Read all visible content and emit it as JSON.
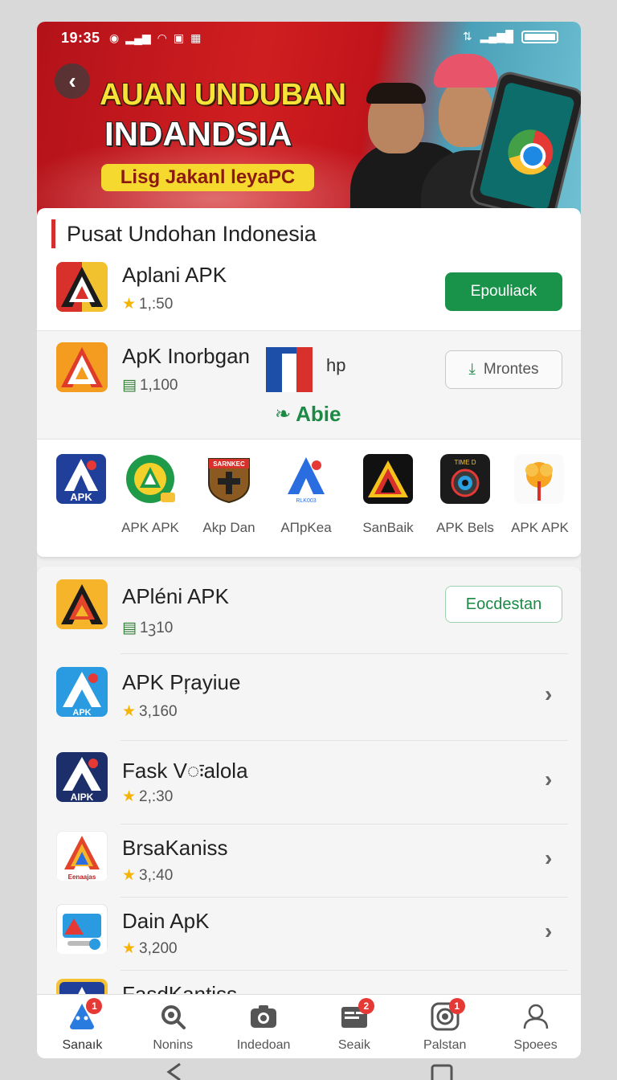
{
  "status_bar": {
    "time": "19:35"
  },
  "banner": {
    "title_line1": "AUAN UNDUBAN",
    "title_line2": "INDANDSIA",
    "pill_text": "Lisg Jakanl leyaPC"
  },
  "section": {
    "title": "Pusat Undohan Indonesia"
  },
  "featured": [
    {
      "name": "Aplani APK",
      "meta": "1,:50",
      "meta_icon": "star-icon",
      "action": "Epouliack"
    },
    {
      "name": "ApK Inorbgan",
      "meta": "1,100",
      "meta_icon": "download-icon",
      "action": "Mrontes",
      "extra_text": "hp",
      "extra_label": "Abie"
    }
  ],
  "icon_grid": [
    {
      "label": ""
    },
    {
      "label": "APK APK"
    },
    {
      "label": "Akp Dan"
    },
    {
      "label": "AΠpKea"
    },
    {
      "label": "SanBaik"
    },
    {
      "label": "APK Bels"
    },
    {
      "label": "APK APK"
    }
  ],
  "icon_grid_texts": {
    "apk_tile": "APK",
    "shield_top": "SARNKEC",
    "tile_small": "RLK003",
    "tile_dark": "TIME D"
  },
  "list": [
    {
      "name": "APléni APK",
      "meta": "1ꝫ10",
      "meta_icon": "download-icon",
      "action": "Eocdestan"
    },
    {
      "name": "APK Pŗayiue",
      "meta": "3,160",
      "meta_icon": "star-icon",
      "icon_text": "APK"
    },
    {
      "name": "Fask Vःalola",
      "meta": "2,:30",
      "meta_icon": "star-icon",
      "icon_text": "AIPK"
    },
    {
      "name": "BrsaKaniss",
      "meta": "3,:40",
      "meta_icon": "star-icon",
      "icon_text": "Eenaajas"
    },
    {
      "name": "Dain ApK",
      "meta": "3,200",
      "meta_icon": "star-icon"
    },
    {
      "name": "FasdKantiss"
    }
  ],
  "bottom_nav": [
    {
      "label": "Sanaık",
      "icon": "home-icon",
      "badge": "1"
    },
    {
      "label": "Nonins",
      "icon": "search-icon",
      "badge": ""
    },
    {
      "label": "Indedoan",
      "icon": "camera-icon",
      "badge": ""
    },
    {
      "label": "Seaik",
      "icon": "folder-icon",
      "badge": "2"
    },
    {
      "label": "Palstan",
      "icon": "settings-icon",
      "badge": "1"
    },
    {
      "label": "Spoees",
      "icon": "person-icon",
      "badge": ""
    }
  ],
  "colors": {
    "accent_green": "#19934a",
    "accent_red": "#d32f2f",
    "star": "#f5b400"
  }
}
